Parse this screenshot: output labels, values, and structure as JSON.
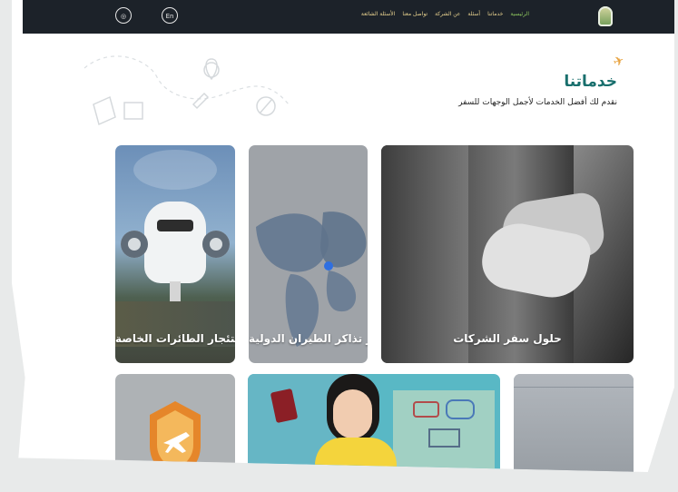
{
  "header": {
    "language_label": "En",
    "logo_text": "",
    "nav": [
      "الرئيسية",
      "خدماتنا",
      "أسئلة",
      "عن الشركة",
      "تواصل معنا",
      "الأسئلة الشائعة"
    ]
  },
  "section": {
    "title": "خدماتنا",
    "subtitle": "نقدم لك أفضل الخدمات لأجمل الوجهات للسفر"
  },
  "services": [
    {
      "label": "حلول سفر الشركات"
    },
    {
      "label": "إصدار تذاكر الطيران الدولية"
    },
    {
      "label": "استئجار الطائرات الخاصة"
    }
  ],
  "icons": [
    "settings-icon",
    "language-icon",
    "logo",
    "plane-icon",
    "map-pin-icon",
    "shield-plane-icon"
  ],
  "colors": {
    "nav": "#1c2229",
    "title": "#196f6d",
    "accent": "#e8a340",
    "active": "#8ec85f"
  }
}
